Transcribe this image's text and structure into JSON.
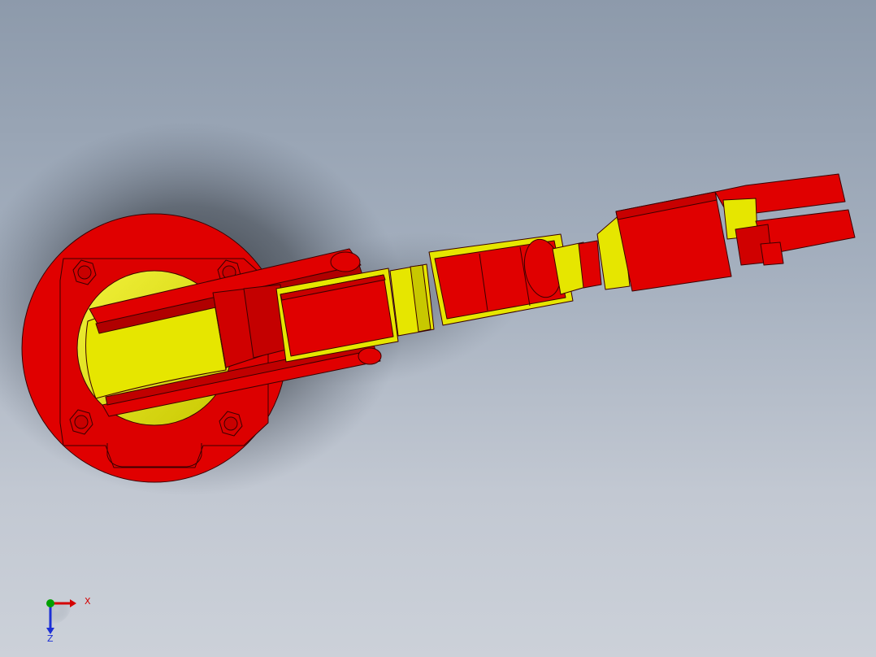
{
  "colors": {
    "part_red": "#e00000",
    "part_red_dark": "#b00000",
    "part_yellow": "#e6e600",
    "part_yellow_dark": "#b8b800",
    "edge": "#3a0000",
    "background_top": "#8d9aab",
    "background_bottom": "#ccd1d9",
    "axis_x": "#d40000",
    "axis_y": "#00a000",
    "axis_z": "#1c2fd6"
  },
  "viewport": {
    "model": "robotic-arm-assembly"
  },
  "triad": {
    "x_label": "X",
    "z_label": "Z"
  }
}
